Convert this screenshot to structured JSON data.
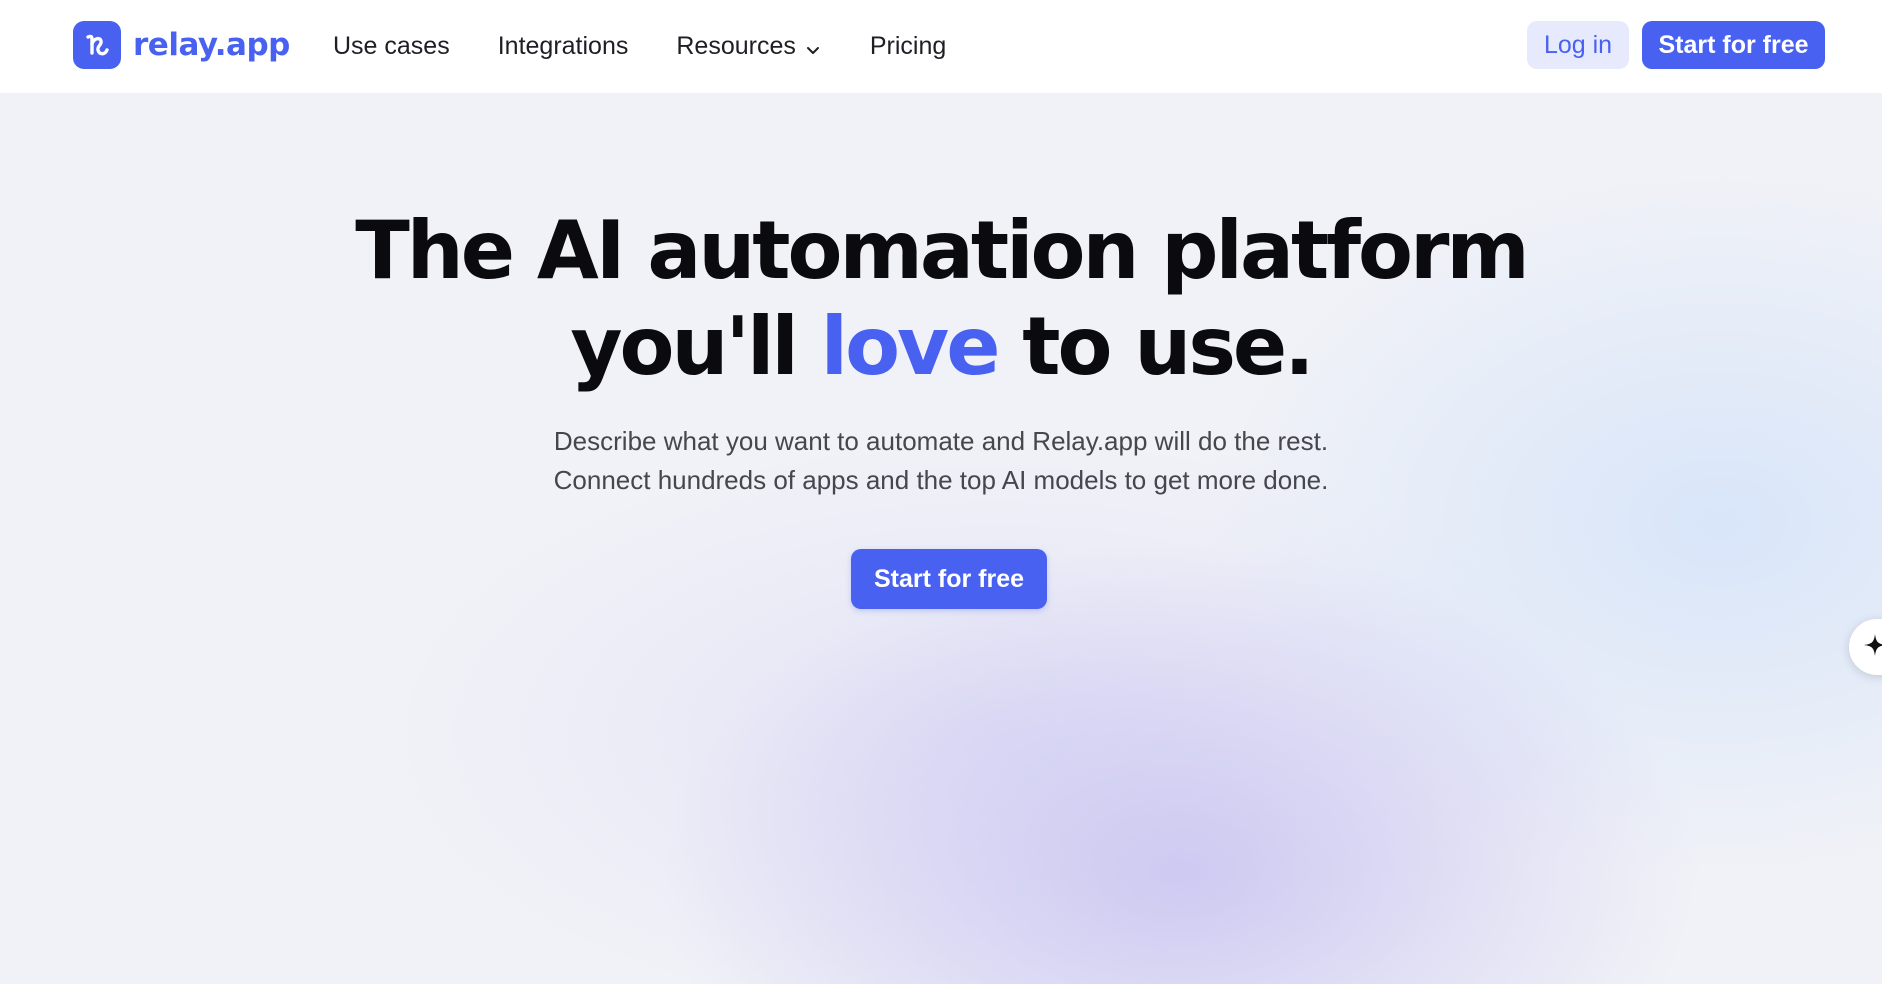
{
  "brand": {
    "name": "relay.app",
    "accent_color": "#4961f0"
  },
  "nav": {
    "links": [
      {
        "label": "Use cases"
      },
      {
        "label": "Integrations"
      },
      {
        "label": "Resources"
      },
      {
        "label": "Pricing"
      }
    ],
    "login_label": "Log in",
    "start_label": "Start for free"
  },
  "hero": {
    "headline_line1": "The AI automation platform",
    "headline_line2_before": "you'll ",
    "headline_accent": "love",
    "headline_line2_after": " to use.",
    "subtext_line1": "Describe what you want to automate and Relay.app will do the rest.",
    "subtext_line2": "Connect hundreds of apps and the top AI models to get more done.",
    "cta_label": "Start for free"
  },
  "icons": {
    "logo": "relay-logo-icon",
    "dropdown": "chevron-down-icon",
    "assistant": "sparkle-icon"
  }
}
